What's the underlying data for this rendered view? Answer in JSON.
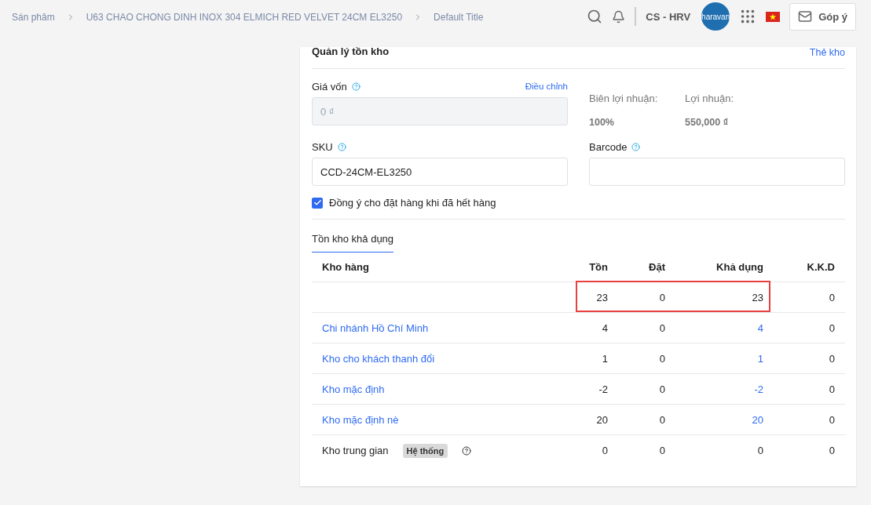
{
  "breadcrumb": [
    "Sán phâm",
    "U63 CHAO CHONG DINH INOX 304 ELMICH RED VELVET 24CM EL3250",
    "Default Title"
  ],
  "header": {
    "account": "CS - HRV",
    "avatar": "haravan",
    "feedback": "Góp ý"
  },
  "card": {
    "title": "Quản lý tồn kho",
    "link": "Thẻ kho",
    "cost": {
      "label": "Giá vốn",
      "action": "Điều chỉnh",
      "placeholder": "0 ₫",
      "disabled": true
    },
    "margin": {
      "label": "Biên lợi nhuận:",
      "value": "100%"
    },
    "profit": {
      "label": "Lợi nhuận:",
      "value": "550,000 ₫"
    },
    "sku": {
      "label": "SKU",
      "value": "CCD-24CM-EL3250"
    },
    "barcode": {
      "label": "Barcode"
    },
    "allow_oversell": {
      "label": "Đồng ý cho đặt hàng khi đã hết hàng",
      "checked": true
    },
    "tabs": [
      {
        "label": "Tồn kho khả dụng",
        "selected": true
      }
    ],
    "table": {
      "columns": [
        "Kho hàng",
        "Tồn",
        "Đặt",
        "Khả dụng",
        "K.K.D"
      ],
      "rows": [
        {
          "kind": "total",
          "cells": [
            "",
            "23",
            "0",
            "23",
            "0"
          ],
          "highlighted": true
        },
        {
          "kind": "link",
          "cells": [
            "Chi nhánh Hồ Chí Minh",
            "4",
            "0",
            "4",
            "0"
          ],
          "highlighted": false
        },
        {
          "kind": "link",
          "cells": [
            "Kho cho khách thanh đổi",
            "1",
            "0",
            "1",
            "0"
          ],
          "highlighted": false
        },
        {
          "kind": "link",
          "cells": [
            "Kho mặc định",
            "-2",
            "0",
            "-2",
            "0"
          ],
          "highlighted": false
        },
        {
          "kind": "link",
          "cells": [
            "Kho mặc định nè",
            "20",
            "0",
            "20",
            "0"
          ],
          "highlighted": false
        },
        {
          "kind": "system",
          "cells": [
            "Kho trung gian",
            "0",
            "0",
            "0",
            "0"
          ],
          "badge": "Hệ thống",
          "highlighted": false
        }
      ]
    }
  }
}
